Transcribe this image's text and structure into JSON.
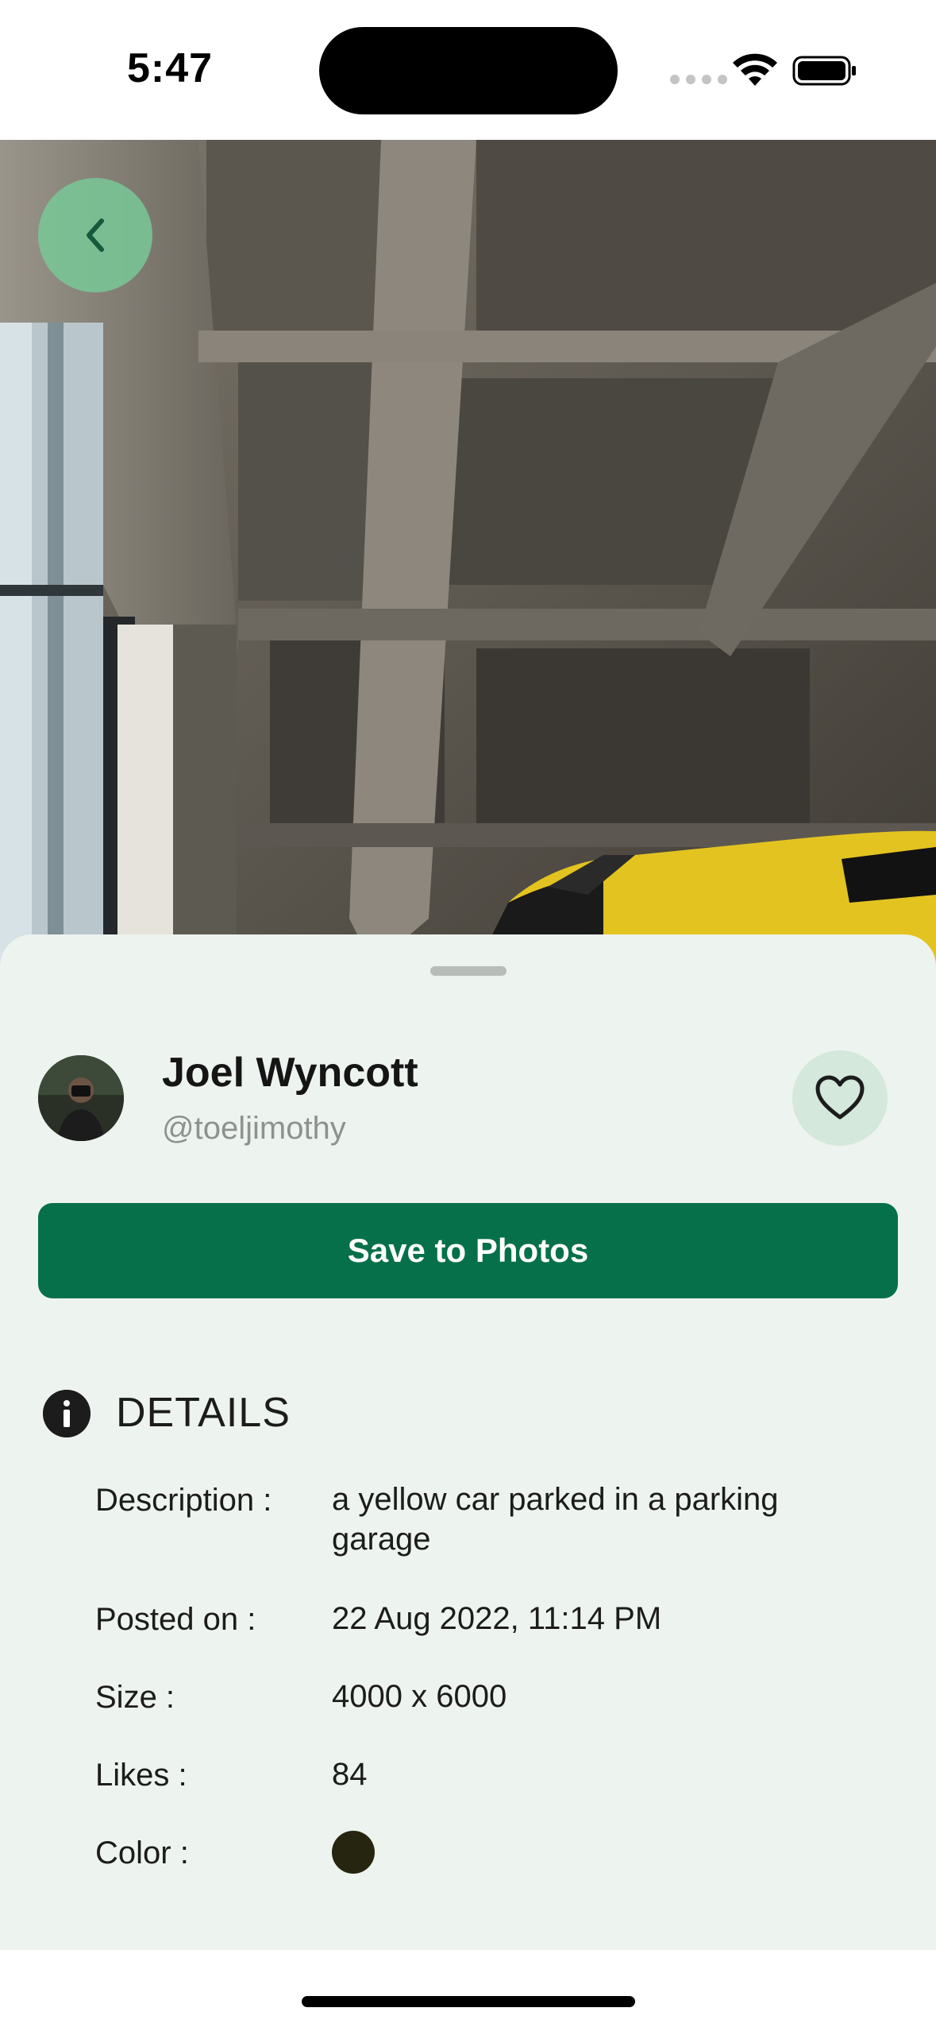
{
  "status_bar": {
    "time": "5:47"
  },
  "photo": {
    "alt": "a yellow car parked in a parking garage"
  },
  "author": {
    "name": "Joel Wyncott",
    "handle": "@toeljimothy"
  },
  "actions": {
    "save_label": "Save to Photos"
  },
  "details": {
    "title": "DETAILS",
    "rows": [
      {
        "label": "Description :",
        "value": "a yellow car parked in a parking garage"
      },
      {
        "label": "Posted on :",
        "value": "22 Aug 2022, 11:14 PM"
      },
      {
        "label": "Size :",
        "value": "4000 x 6000"
      },
      {
        "label": "Likes :",
        "value": "84"
      },
      {
        "label": "Color :",
        "value": ""
      }
    ],
    "color_hex": "#262510"
  },
  "colors": {
    "accent": "#06704a",
    "sheet_background": "#edf3ee",
    "back_button": "#78c896",
    "like_button": "#d4e8db"
  }
}
